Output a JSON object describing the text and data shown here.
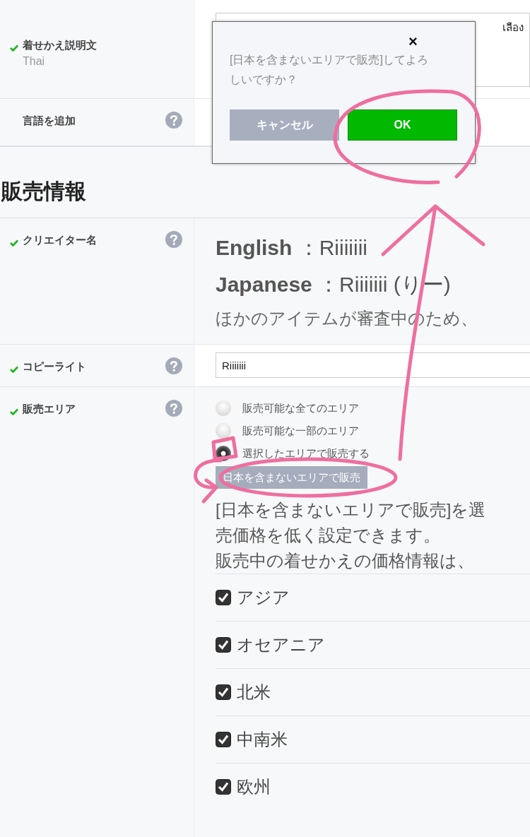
{
  "fields": [
    {
      "label": "着せかえ説明文",
      "sublabel": "Thai",
      "required": true,
      "help": false,
      "kind": "textarea",
      "value": "เลือง"
    },
    {
      "label": "言語を追加",
      "required": false,
      "help": true,
      "kind": "empty"
    }
  ],
  "section_title": "販売情報",
  "sales_fields": [
    {
      "label": "クリエイター名",
      "required": true,
      "help": true,
      "kind": "creator",
      "lines": [
        {
          "key": "English",
          "value": "：Riiiiiii"
        },
        {
          "key": "Japanese",
          "value": "：Riiiiiii (りー)"
        }
      ],
      "note": "ほかのアイテムが審査中のため、"
    },
    {
      "label": "コピーライト",
      "required": true,
      "help": true,
      "kind": "input",
      "value": "Riiiiiii"
    },
    {
      "label": "販売エリア",
      "required": true,
      "help": true,
      "kind": "area",
      "options": [
        {
          "label": "販売可能な全てのエリア",
          "selected": false
        },
        {
          "label": "販売可能な一部のエリア",
          "selected": false
        },
        {
          "label": "選択したエリアで販売する",
          "selected": true
        }
      ],
      "area_button": "日本を含まないエリアで販売",
      "description": [
        "[日本を含まないエリアで販売]を選",
        "売価格を低く設定できます。",
        "販売中の着せかえの価格情報は、"
      ],
      "regions": [
        {
          "label": "アジア",
          "checked": true
        },
        {
          "label": "オセアニア",
          "checked": true
        },
        {
          "label": "北米",
          "checked": true
        },
        {
          "label": "中南米",
          "checked": true
        },
        {
          "label": "欧州",
          "checked": true
        }
      ]
    }
  ],
  "dialog": {
    "close": "×",
    "message": "[日本を含まないエリアで販売]してよろしいですか？",
    "buttons": [
      {
        "label": "キャンセル",
        "kind": "cancel"
      },
      {
        "label": "OK",
        "kind": "primary"
      }
    ]
  }
}
